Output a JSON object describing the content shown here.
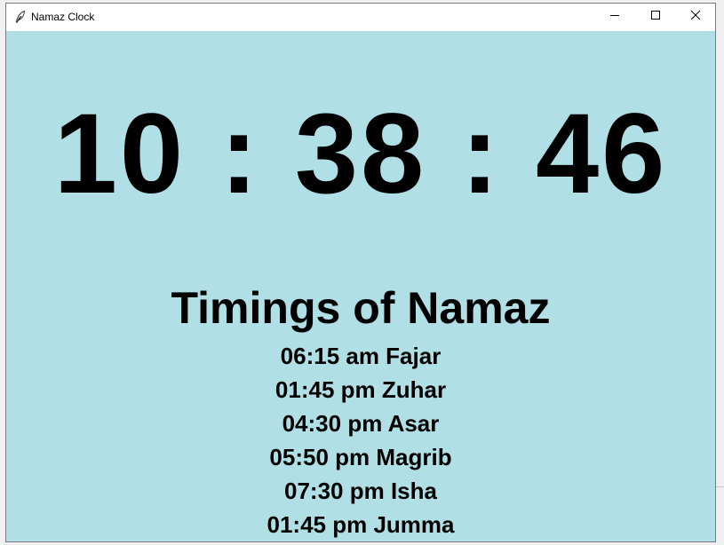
{
  "window": {
    "title": "Namaz Clock",
    "icon": "feather-icon"
  },
  "titlebar_buttons": {
    "minimize_icon": "minimize-icon",
    "maximize_icon": "maximize-icon",
    "close_icon": "close-icon"
  },
  "clock": {
    "time": "10 : 38 : 46"
  },
  "timings": {
    "heading": "Timings of Namaz",
    "items": [
      "06:15 am Fajar",
      "01:45 pm Zuhar",
      "04:30 pm Asar",
      "05:50 pm Magrib",
      "07:30 pm Isha",
      "01:45 pm Jumma"
    ]
  },
  "colors": {
    "background": "#b0dfe5",
    "text": "#000000",
    "titlebar": "#ffffff"
  }
}
